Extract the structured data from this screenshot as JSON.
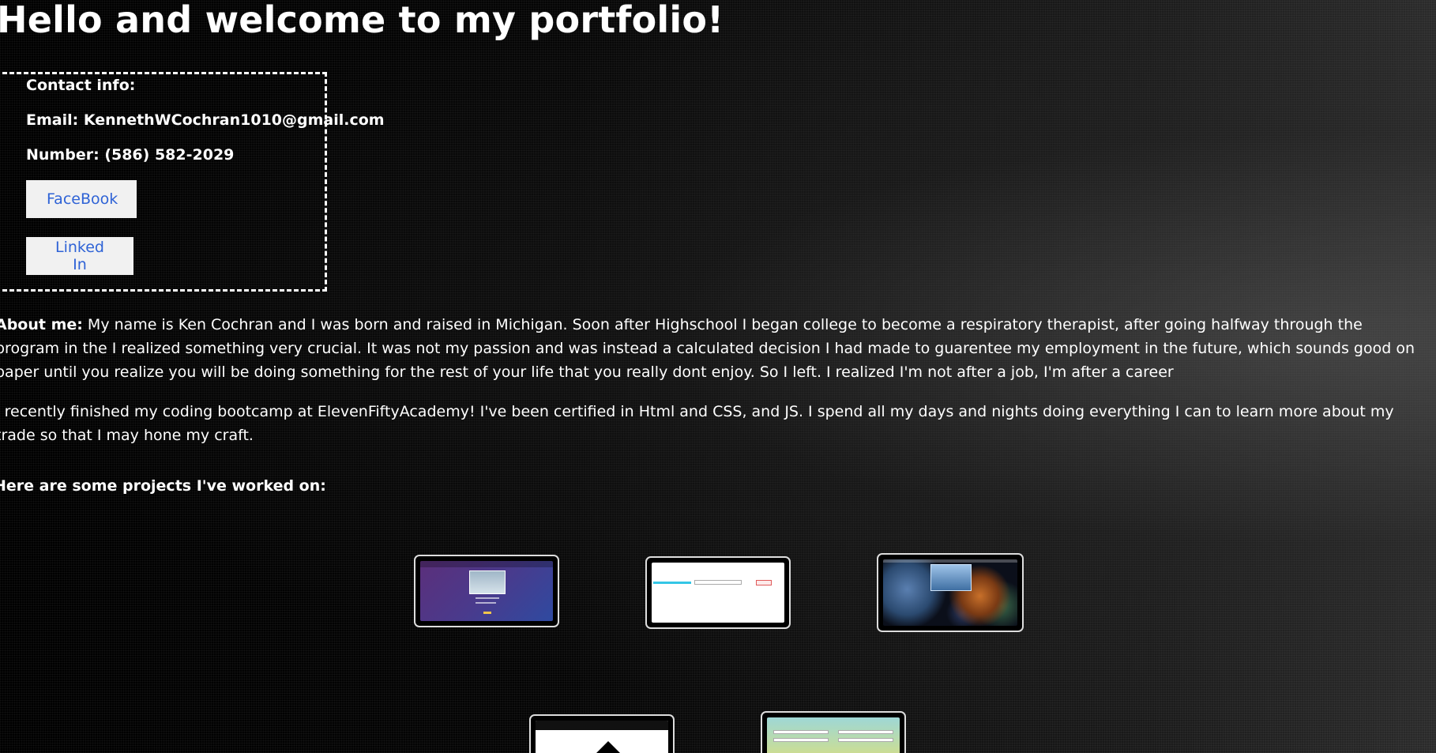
{
  "header": {
    "title": "Hello and welcome to my portfolio!"
  },
  "contact": {
    "heading": "Contact info:",
    "email_label": "Email:",
    "email_value": "KennethWCochran1010@gmail.com",
    "number_label": "Number:",
    "number_value": "(586) 582-2029",
    "facebook_label": "FaceBook",
    "linkedin_label": "Linked In"
  },
  "about": {
    "label": "About me:",
    "text": "My name is Ken Cochran and I was born and raised in Michigan. Soon after Highschool I began college to become a respiratory therapist, after going halfway through the program in the I realized something very crucial. It was not my passion and was instead a calculated decision I had made to guarentee my employment in the future, which sounds good on paper until you realize you will be doing something for the rest of your life that you really dont enjoy. So I left. I realized I'm not after a job, I'm after a career",
    "bootcamp_text": "I recently finished my coding bootcamp at ElevenFiftyAcademy! I've been certified in Html and CSS, and JS. I spend all my days and nights doing everything I can to learn more about my trade so that I may hone my craft."
  },
  "projects": {
    "heading": "Here are some projects I've worked on:"
  },
  "colors": {
    "link_blue": "#2f63d6",
    "button_bg": "#f1f1f1"
  }
}
